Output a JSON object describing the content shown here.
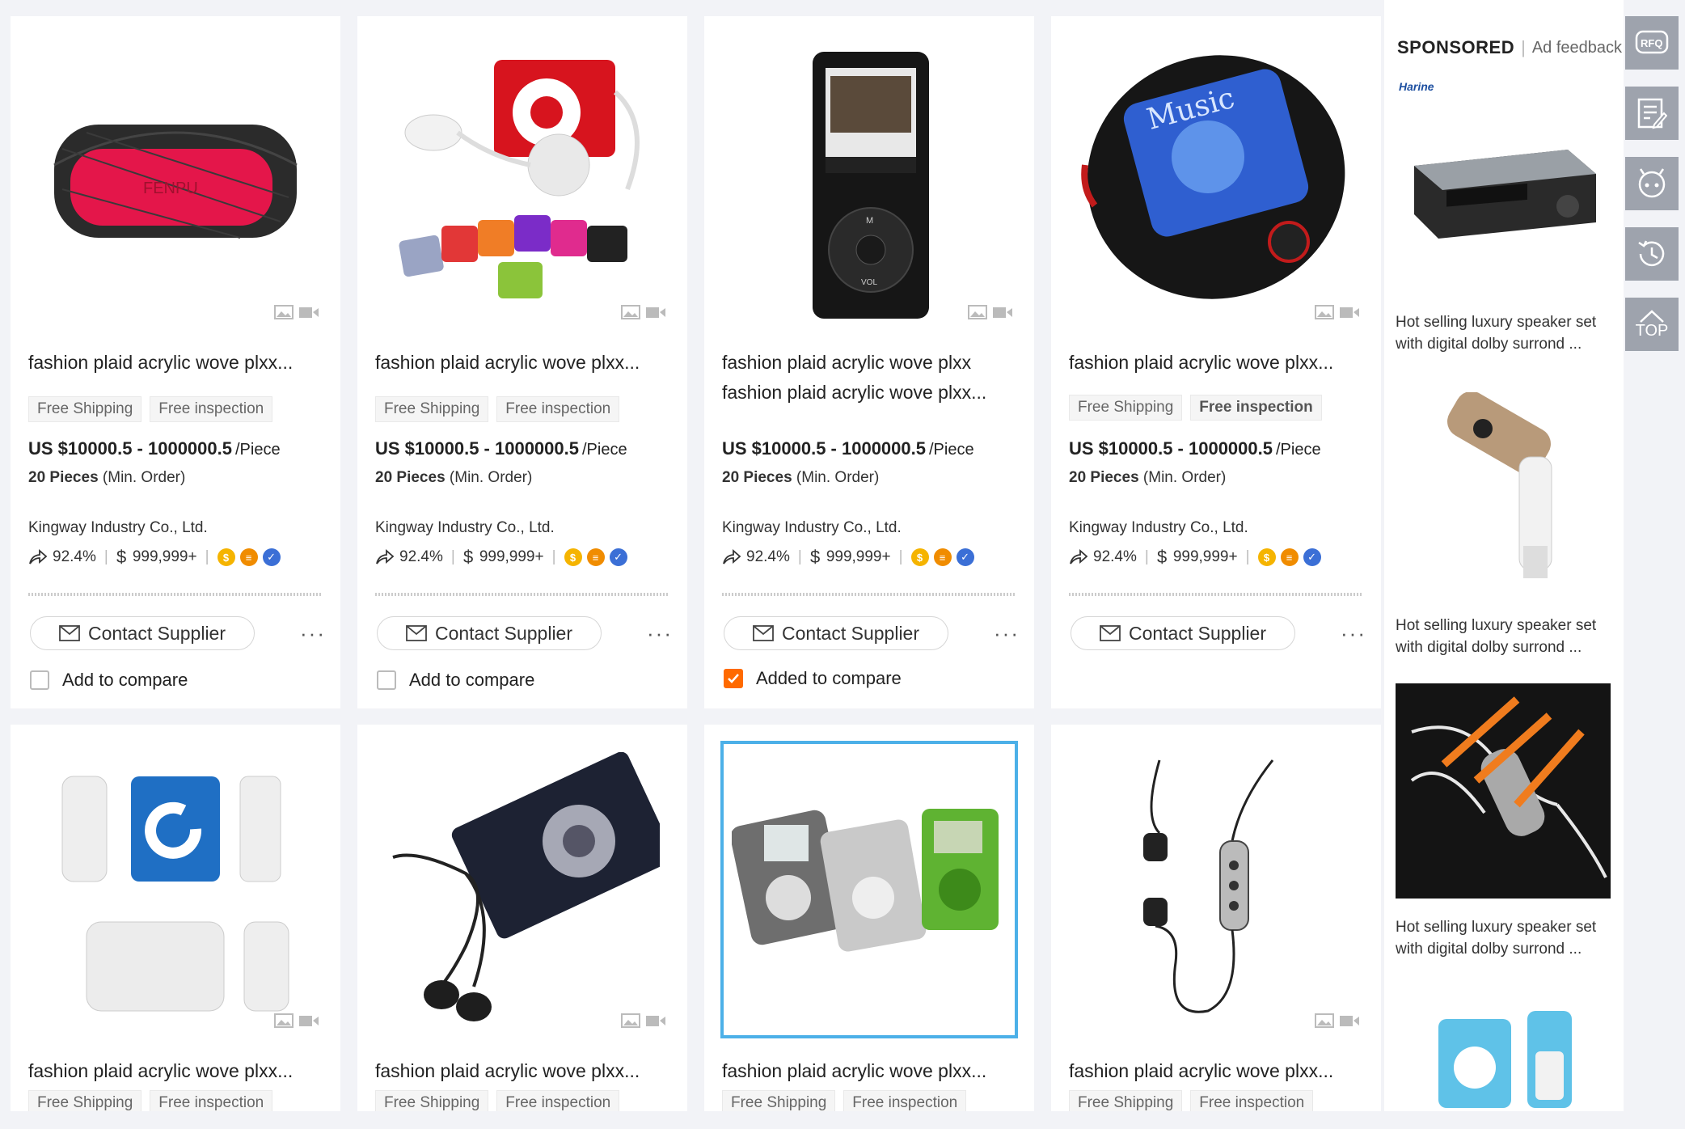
{
  "colors": {
    "accent": "#ff6a00",
    "selected_outline": "#4cb0e8",
    "rail": "#9ea3ad"
  },
  "products": [
    {
      "title": "fashion plaid acrylic wove  plxx...",
      "tags": [
        "Free Shipping",
        "Free inspection"
      ],
      "price": "US $10000.5 - 1000000.5",
      "unit": "/Piece",
      "moq_qty": "20 Pieces",
      "moq_label": "(Min. Order)",
      "supplier": "Kingway Industry Co., Ltd.",
      "rate": "92.4%",
      "revenue": "999,999+",
      "contact": "Contact Supplier",
      "more": "···",
      "compare": "Add to compare",
      "compare_checked": false,
      "image": "speaker"
    },
    {
      "title": "fashion plaid acrylic wove  plxx...",
      "tags": [
        "Free Shipping",
        "Free inspection"
      ],
      "price": "US $10000.5 - 1000000.5",
      "unit": "/Piece",
      "moq_qty": "20 Pieces",
      "moq_label": "(Min. Order)",
      "supplier": "Kingway Industry Co., Ltd.",
      "rate": "92.4%",
      "revenue": "999,999+",
      "contact": "Contact Supplier",
      "more": "···",
      "compare": "Add to compare",
      "compare_checked": false,
      "image": "clip-players"
    },
    {
      "title": "fashion plaid acrylic wove  plxx fashion plaid acrylic wove  plxx...",
      "tags": [],
      "price": "US $10000.5 - 1000000.5",
      "unit": "/Piece",
      "moq_qty": "20 Pieces",
      "moq_label": "(Min. Order)",
      "supplier": "Kingway Industry Co., Ltd.",
      "rate": "92.4%",
      "revenue": "999,999+",
      "contact": "Contact Supplier",
      "more": "···",
      "compare": "Added to compare",
      "compare_checked": true,
      "image": "mp3-black"
    },
    {
      "title": "fashion plaid acrylic wove  plxx...",
      "tags": [
        "Free Shipping",
        "Free inspection"
      ],
      "price": "US $10000.5 - 1000000.5",
      "unit": "/Piece",
      "moq_qty": "20 Pieces",
      "moq_label": "(Min. Order)",
      "supplier": "Kingway Industry Co., Ltd.",
      "rate": "92.4%",
      "revenue": "999,999+",
      "contact": "Contact Supplier",
      "more": "···",
      "compare": "",
      "compare_checked": false,
      "image": "music-player"
    },
    {
      "title": "fashion plaid acrylic wove  plxx...",
      "tags": [
        "Free Shipping",
        "Free inspection"
      ],
      "image": "blue-clip"
    },
    {
      "title": "fashion plaid acrylic wove  plxx...",
      "tags": [
        "Free Shipping",
        "Free inspection"
      ],
      "image": "card-player"
    },
    {
      "title": "fashion plaid acrylic wove  plxx...",
      "tags": [
        "Free Shipping",
        "Free inspection"
      ],
      "image": "lcd-players"
    },
    {
      "title": "fashion plaid acrylic wove  plxx...",
      "tags": [
        "Free Shipping",
        "Free inspection"
      ],
      "image": "earphones"
    }
  ],
  "sponsored": {
    "title": "SPONSORED",
    "feedback": "Ad feedback",
    "items": [
      {
        "text": "Hot selling luxury speaker set with digital dolby surrond ...",
        "brand": "Harine",
        "image": "car-radio"
      },
      {
        "text": "Hot selling luxury speaker set with digital dolby surrond ...",
        "image": "fm-transmitter"
      },
      {
        "text": "Hot selling luxury speaker set with digital dolby surrond ...",
        "image": "earbuds"
      },
      {
        "text": "",
        "image": "blue-clip-player"
      }
    ]
  },
  "rail": {
    "rfq": "RFQ",
    "top": "TOP",
    "icons": [
      "rfq-icon",
      "edit-icon",
      "chat-icon",
      "history-icon",
      "top-icon"
    ]
  }
}
